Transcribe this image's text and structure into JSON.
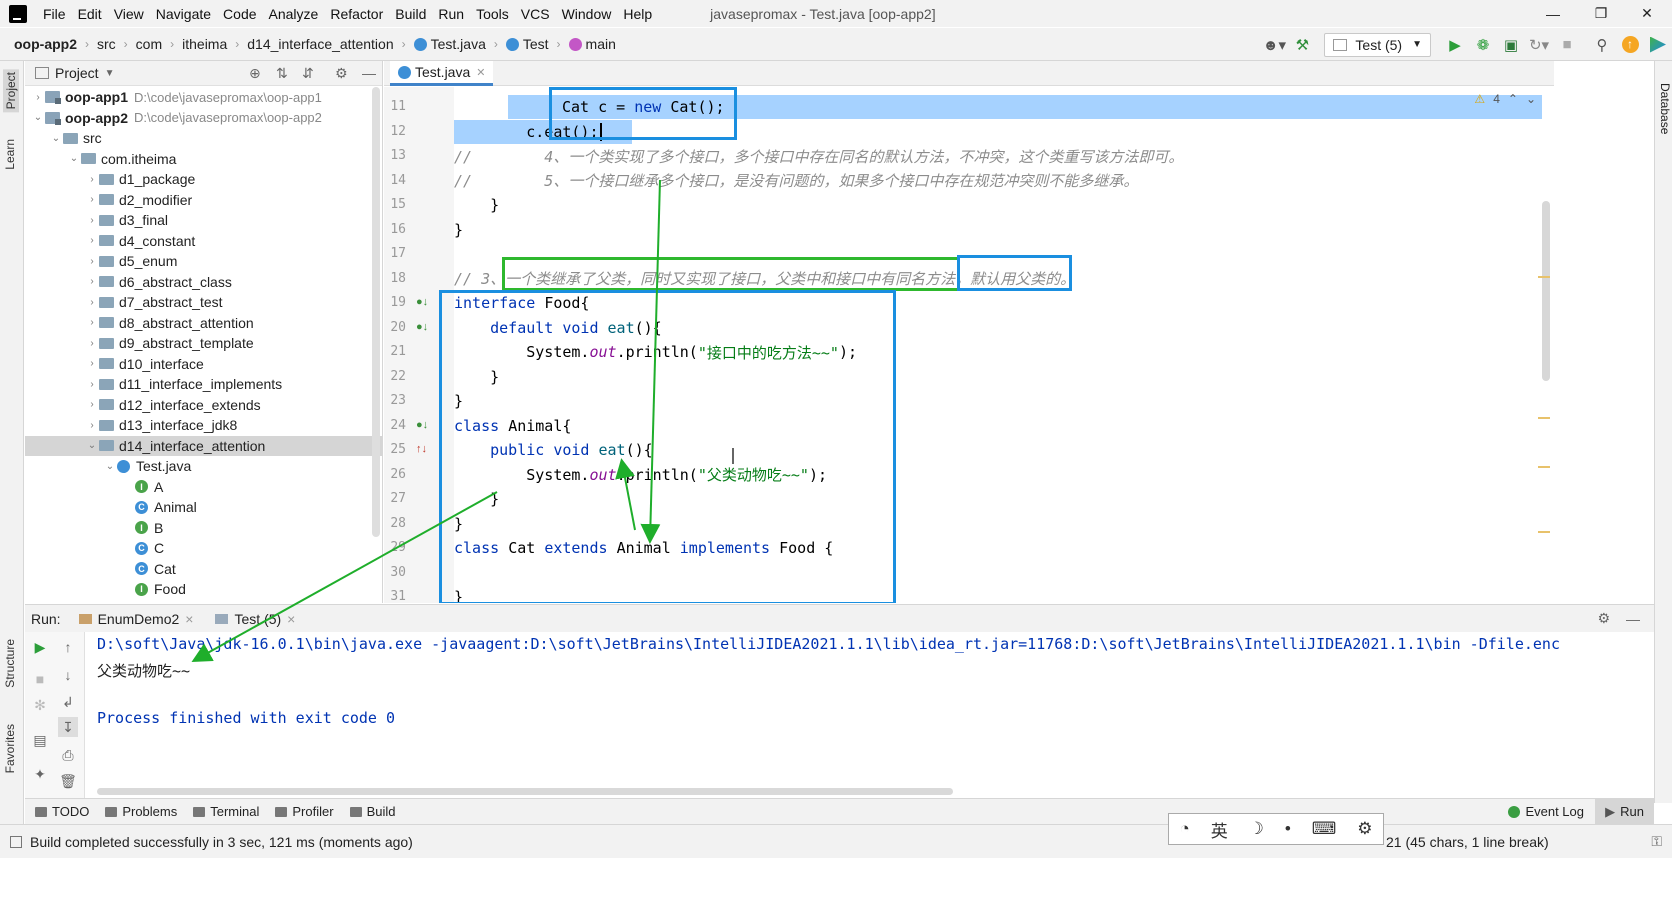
{
  "menubar": {
    "items": [
      "File",
      "Edit",
      "View",
      "Navigate",
      "Code",
      "Analyze",
      "Refactor",
      "Build",
      "Run",
      "Tools",
      "VCS",
      "Window",
      "Help"
    ],
    "window_title": "javasepromax - Test.java [oop-app2]",
    "controls": {
      "minimize": "—",
      "maximize": "❐",
      "close": "✕"
    }
  },
  "breadcrumb": {
    "items": [
      "oop-app2",
      "src",
      "com",
      "itheima",
      "d14_interface_attention",
      "Test.java",
      "Test",
      "main"
    ]
  },
  "toolbar": {
    "run_config": "Test (5)",
    "icons": [
      "user-icon",
      "build-hammer-icon",
      "run-icon",
      "debug-icon",
      "coverage-icon",
      "profile-icon",
      "stop-icon",
      "search-icon",
      "update-icon",
      "toolbox-icon"
    ]
  },
  "left_strip": {
    "project": "Project",
    "learn": "Learn",
    "structure": "Structure",
    "favorites": "Favorites"
  },
  "right_strip": {
    "database": "Database"
  },
  "project_panel": {
    "title": "Project",
    "tree": [
      {
        "label": "oop-app1",
        "path": "D:\\code\\javasepromax\\oop-app1",
        "level": 0,
        "kind": "module",
        "expanded": false
      },
      {
        "label": "oop-app2",
        "path": "D:\\code\\javasepromax\\oop-app2",
        "level": 0,
        "kind": "module",
        "expanded": true
      },
      {
        "label": "src",
        "level": 1,
        "kind": "folder",
        "expanded": true
      },
      {
        "label": "com.itheima",
        "level": 2,
        "kind": "folder",
        "expanded": true
      },
      {
        "label": "d1_package",
        "level": 3,
        "kind": "folder",
        "expanded": false
      },
      {
        "label": "d2_modifier",
        "level": 3,
        "kind": "folder",
        "expanded": false
      },
      {
        "label": "d3_final",
        "level": 3,
        "kind": "folder",
        "expanded": false
      },
      {
        "label": "d4_constant",
        "level": 3,
        "kind": "folder",
        "expanded": false
      },
      {
        "label": "d5_enum",
        "level": 3,
        "kind": "folder",
        "expanded": false
      },
      {
        "label": "d6_abstract_class",
        "level": 3,
        "kind": "folder",
        "expanded": false
      },
      {
        "label": "d7_abstract_test",
        "level": 3,
        "kind": "folder",
        "expanded": false
      },
      {
        "label": "d8_abstract_attention",
        "level": 3,
        "kind": "folder",
        "expanded": false
      },
      {
        "label": "d9_abstract_template",
        "level": 3,
        "kind": "folder",
        "expanded": false
      },
      {
        "label": "d10_interface",
        "level": 3,
        "kind": "folder",
        "expanded": false
      },
      {
        "label": "d11_interface_implements",
        "level": 3,
        "kind": "folder",
        "expanded": false
      },
      {
        "label": "d12_interface_extends",
        "level": 3,
        "kind": "folder",
        "expanded": false
      },
      {
        "label": "d13_interface_jdk8",
        "level": 3,
        "kind": "folder",
        "expanded": false
      },
      {
        "label": "d14_interface_attention",
        "level": 3,
        "kind": "folder",
        "expanded": true,
        "selected": true
      },
      {
        "label": "Test.java",
        "level": 4,
        "kind": "javafile",
        "expanded": true
      },
      {
        "label": "A",
        "level": 5,
        "kind": "interface"
      },
      {
        "label": "Animal",
        "level": 5,
        "kind": "class"
      },
      {
        "label": "B",
        "level": 5,
        "kind": "interface"
      },
      {
        "label": "C",
        "level": 5,
        "kind": "class"
      },
      {
        "label": "Cat",
        "level": 5,
        "kind": "class"
      },
      {
        "label": "Food",
        "level": 5,
        "kind": "interface"
      }
    ]
  },
  "editor": {
    "tab": "Test.java",
    "warnings": "4",
    "lines": [
      {
        "n": "11",
        "tokens": [
          [
            "",
            "        "
          ],
          [
            "",
            "Cat c = "
          ],
          [
            "kw",
            "new "
          ],
          [
            "",
            "Cat();"
          ]
        ],
        "selected": true
      },
      {
        "n": "12",
        "tokens": [
          [
            "",
            "        c.eat();"
          ]
        ],
        "selected": true
      },
      {
        "n": "13",
        "tokens": [
          [
            "cm",
            "//        4、一个类实现了多个接口，多个接口中存在同名的默认方法，不冲突，这个类重写该方法即可。"
          ]
        ]
      },
      {
        "n": "14",
        "tokens": [
          [
            "cm",
            "//        5、一个接口继承多个接口，是没有问题的，如果多个接口中存在规范冲突则不能多继承。"
          ]
        ]
      },
      {
        "n": "15",
        "tokens": [
          [
            "",
            "    }"
          ]
        ]
      },
      {
        "n": "16",
        "tokens": [
          [
            "",
            "}"
          ]
        ]
      },
      {
        "n": "17",
        "tokens": [
          [
            "",
            ""
          ]
        ]
      },
      {
        "n": "18",
        "tokens": [
          [
            "cm",
            "// 3、一个类继承了父类，同时又实现了接口，父类中和接口中有同名方法，默认用父类的。"
          ]
        ]
      },
      {
        "n": "19",
        "tokens": [
          [
            "kw",
            "interface "
          ],
          [
            "",
            "Food{"
          ]
        ]
      },
      {
        "n": "20",
        "tokens": [
          [
            "",
            "    "
          ],
          [
            "kw",
            "default void "
          ],
          [
            "fn",
            "eat"
          ],
          [
            "",
            "(){"
          ]
        ]
      },
      {
        "n": "21",
        "tokens": [
          [
            "",
            "        System."
          ],
          [
            "it",
            "out"
          ],
          [
            "",
            ".println("
          ],
          [
            "str",
            "\"接口中的吃方法~~\""
          ],
          [
            "",
            ");"
          ]
        ]
      },
      {
        "n": "22",
        "tokens": [
          [
            "",
            "    }"
          ]
        ]
      },
      {
        "n": "23",
        "tokens": [
          [
            "",
            "}"
          ]
        ]
      },
      {
        "n": "24",
        "tokens": [
          [
            "kw",
            "class "
          ],
          [
            "",
            "Animal{"
          ]
        ]
      },
      {
        "n": "25",
        "tokens": [
          [
            "",
            "    "
          ],
          [
            "kw",
            "public void "
          ],
          [
            "fn",
            "eat"
          ],
          [
            "",
            "(){"
          ]
        ]
      },
      {
        "n": "26",
        "tokens": [
          [
            "",
            "        System."
          ],
          [
            "it",
            "out"
          ],
          [
            "",
            ".println("
          ],
          [
            "str",
            "\"父类动物吃~~\""
          ],
          [
            "",
            ");"
          ]
        ]
      },
      {
        "n": "27",
        "tokens": [
          [
            "",
            "    }"
          ]
        ]
      },
      {
        "n": "28",
        "tokens": [
          [
            "",
            "}"
          ]
        ]
      },
      {
        "n": "29",
        "tokens": [
          [
            "kw",
            "class "
          ],
          [
            "",
            "Cat "
          ],
          [
            "kw",
            "extends "
          ],
          [
            "",
            "Animal "
          ],
          [
            "kw",
            "implements "
          ],
          [
            "",
            "Food {"
          ]
        ]
      },
      {
        "n": "30",
        "tokens": [
          [
            "",
            ""
          ]
        ]
      },
      {
        "n": "31",
        "tokens": [
          [
            "",
            "}"
          ]
        ]
      }
    ]
  },
  "run_panel": {
    "label": "Run:",
    "tabs": [
      "EnumDemo2",
      "Test (5)"
    ],
    "console": [
      {
        "text": "D:\\soft\\Java\\jdk-16.0.1\\bin\\java.exe -javaagent:D:\\soft\\JetBrains\\IntelliJIDEA2021.1.1\\lib\\idea_rt.jar=11768:D:\\soft\\JetBrains\\IntelliJIDEA2021.1.1\\bin -Dfile.enc",
        "color": "#0033b3"
      },
      {
        "text": "父类动物吃~~",
        "color": "#222222"
      },
      {
        "text": "",
        "color": "#222222"
      },
      {
        "text": "Process finished with exit code 0",
        "color": "#0033b3"
      }
    ]
  },
  "bottom_tabs": [
    "TODO",
    "Problems",
    "Terminal",
    "Profiler",
    "Build"
  ],
  "bottom_right": {
    "event_log": "Event Log",
    "run": "Run"
  },
  "status": {
    "message": "Build completed successfully in 3 sec, 121 ms (moments ago)",
    "position": "21 (45 chars, 1 line break)",
    "ime": [
      "英"
    ]
  },
  "colors": {
    "accent": "#1a8fe0",
    "arrow": "#1fae2b",
    "selection": "#a6d2ff"
  }
}
